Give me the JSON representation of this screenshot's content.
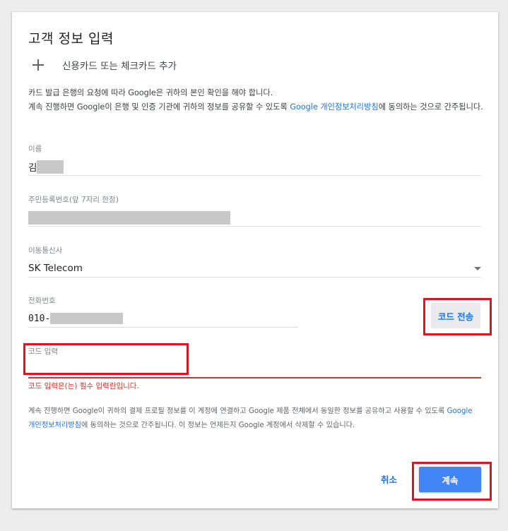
{
  "dialog": {
    "title": "고객 정보 입력",
    "add_card_label": "신용카드 또는 체크카드 추가",
    "notice_line1": "카드 발급 은행의 요청에 따라 Google은 귀하의 본인 확인을 해야 합니다.",
    "notice_line2_prefix": "계속 진행하면 Google이 은행 및 인증 기관에 귀하의 정보를 공유할 수 있도록 ",
    "notice_link": "Google 개인정보처리방침",
    "notice_line2_suffix": "에 동의하는 것으로 간주됩니다."
  },
  "fields": {
    "name": {
      "label": "이름",
      "value_visible": "김"
    },
    "resident_id": {
      "label": "주민등록번호(앞 7자리 한정)"
    },
    "carrier": {
      "label": "이동통신사",
      "value": "SK Telecom"
    },
    "phone": {
      "label": "전화번호",
      "value_visible": "010-"
    },
    "code": {
      "label": "코드 입력",
      "error": "코드 입력은(는) 필수 입력란입니다."
    }
  },
  "buttons": {
    "send_code": "코드 전송",
    "cancel": "취소",
    "continue": "계속"
  },
  "footer": {
    "prefix": "계속 진행하면 Google이 귀하의 결제 프로필 정보를 이 계정에 연결하고 Google 제품 전체에서 동일한 정보를 공유하고 사용할 수 있도록 ",
    "link": "Google 개인정보처리방침",
    "suffix": "에 동의하는 것으로 간주됩니다. 이 정보는 언제든지 Google 계정에서 삭제할 수 있습니다."
  },
  "colors": {
    "accent": "#1a73e8",
    "primary_button": "#4285f4",
    "error": "#d93025",
    "highlight": "#e0141e"
  }
}
